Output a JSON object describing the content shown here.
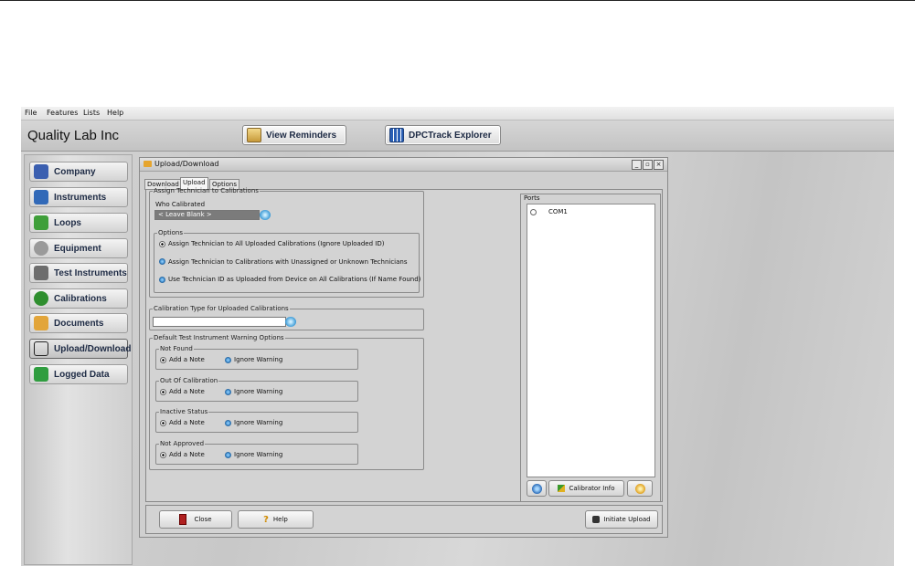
{
  "menu": [
    "File",
    "Features",
    "Lists",
    "Help"
  ],
  "company_name": "Quality Lab Inc",
  "toolbar": {
    "view_reminders": "View Reminders",
    "dpctrack_explorer": "DPCTrack Explorer"
  },
  "sidebar": {
    "items": [
      {
        "label": "Company",
        "icon": "company-icon",
        "color": "#3b5fb0"
      },
      {
        "label": "Instruments",
        "icon": "instruments-icon",
        "color": "#3169b8"
      },
      {
        "label": "Loops",
        "icon": "loops-icon",
        "color": "#3f9f3a"
      },
      {
        "label": "Equipment",
        "icon": "equipment-icon",
        "color": "#9a9a9a"
      },
      {
        "label": "Test Instruments",
        "icon": "test-instruments-icon",
        "color": "#6d6d6d"
      },
      {
        "label": "Calibrations",
        "icon": "calibrations-icon",
        "color": "#2f8f2f"
      },
      {
        "label": "Documents",
        "icon": "documents-icon",
        "color": "#e2a53a"
      },
      {
        "label": "Upload/Download",
        "icon": "upload-download-icon",
        "color": "#222222"
      },
      {
        "label": "Logged Data",
        "icon": "logged-data-icon",
        "color": "#2f9d3f"
      }
    ],
    "active": "Upload/Download"
  },
  "window": {
    "title": "Upload/Download",
    "tabs": [
      "Download",
      "Upload",
      "Options"
    ],
    "active_tab": "Upload"
  },
  "assign": {
    "legend": "Assign Technician to Calibrations",
    "who_label": "Who Calibrated",
    "who_value": "< Leave Blank >",
    "options_legend": "Options",
    "options": [
      "Assign Technician to All Uploaded Calibrations (Ignore Uploaded ID)",
      "Assign Technician to Calibrations with Unassigned or Unknown Technicians",
      "Use Technician ID as Uploaded from Device on All Calibrations (If Name Found)"
    ],
    "selected": 0
  },
  "cal_type": {
    "legend": "Calibration Type for Uploaded Calibrations",
    "value": ""
  },
  "warnings": {
    "legend": "Default Test Instrument Warning Options",
    "groups": [
      {
        "title": "Not Found",
        "opt1": "Add a Note",
        "opt2": "Ignore Warning"
      },
      {
        "title": "Out Of Calibration",
        "opt1": "Add a Note",
        "opt2": "Ignore Warning"
      },
      {
        "title": "Inactive Status",
        "opt1": "Add a Note",
        "opt2": "Ignore Warning"
      },
      {
        "title": "Not Approved",
        "opt1": "Add a Note",
        "opt2": "Ignore Warning"
      }
    ]
  },
  "ports": {
    "legend": "Ports",
    "items": [
      "COM1"
    ],
    "calibrator_info": "Calibrator Info"
  },
  "bottom": {
    "close": "Close",
    "help": "Help",
    "initiate_upload": "Initiate Upload"
  }
}
